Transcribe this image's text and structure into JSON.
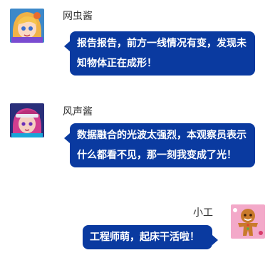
{
  "messages": [
    {
      "sender": "网虫酱",
      "text": "报告报告，前方一线情况有变，发现未知物体正在成形！",
      "side": "left",
      "avatar_icon": "blonde-girl-avatar-icon"
    },
    {
      "sender": "风声酱",
      "text": "数据融合的光波太强烈，本观察员表示什么都看不见，那一刻我变成了光！",
      "side": "left",
      "avatar_icon": "pink-hair-girl-avatar-icon"
    },
    {
      "sender": "小工",
      "text": "工程师萌，起床干活啦！",
      "side": "right",
      "avatar_icon": "gingerbread-man-avatar-icon"
    }
  ],
  "colors": {
    "bubble": "#0a3aa0",
    "bubble_text": "#ffffff",
    "name_text": "#333333"
  }
}
